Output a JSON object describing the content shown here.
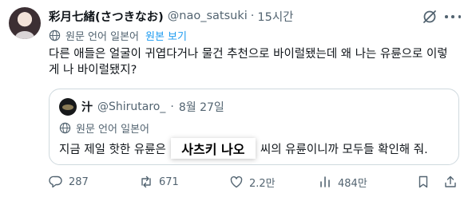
{
  "tweet": {
    "display_name": "彩月七緒(さつきなお)",
    "handle": "@nao_satsuki",
    "separator": "·",
    "time": "15시간",
    "translate_meta": "원문 언어 일본어",
    "translate_link": "원본 보기",
    "text": "다른 애들은 얼굴이 귀엽다거나 물건 추천으로 바이럴됐는데 왜 나는 유륜으로 이렇게 나 바이럴됐지?",
    "quote": {
      "display_name": "汁",
      "handle": "@Shirutaro_",
      "separator": "·",
      "date": "8월 27일",
      "translate_meta": "원문 언어 일본어",
      "text_before": "지금 제일 핫한 유륜은",
      "highlight": "사츠키 나오",
      "text_after": "씨의 유륜이니까 모두들 확인해 줘."
    },
    "actions": {
      "replies": "287",
      "reposts": "671",
      "likes": "2.2만",
      "views": "484만"
    }
  },
  "colors": {
    "text": "#0f1419",
    "muted": "#536471",
    "link": "#1d9bf0",
    "border": "#cfd9de"
  },
  "icons": [
    "grok-icon",
    "more-icon",
    "translate-globe-icon",
    "reply-icon",
    "retweet-icon",
    "like-icon",
    "views-icon",
    "bookmark-icon",
    "share-icon"
  ]
}
